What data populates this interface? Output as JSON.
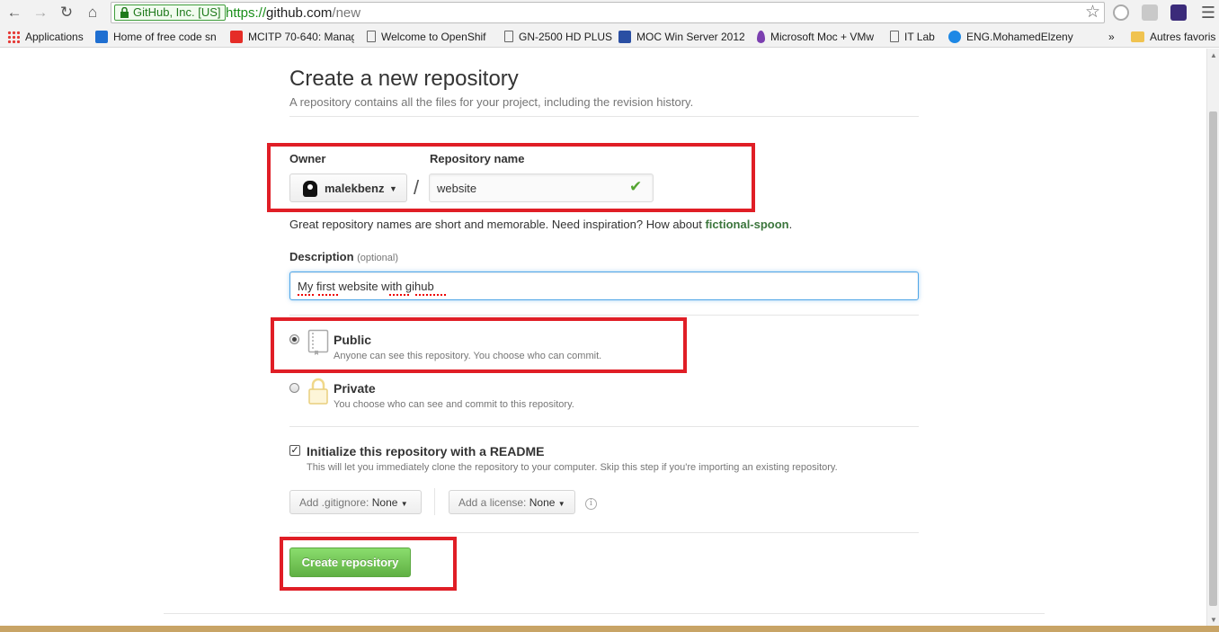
{
  "browser": {
    "ev_badge": "GitHub, Inc. [US]",
    "url_scheme": "https://",
    "url_host": "github.com",
    "url_path": "/new",
    "bookmarks": [
      {
        "label": "Applications"
      },
      {
        "label": "Home of free code sn"
      },
      {
        "label": "MCITP 70-640: Manag"
      },
      {
        "label": "Welcome to OpenShif"
      },
      {
        "label": "GN-2500 HD PLUS"
      },
      {
        "label": "MOC Win Server 2012"
      },
      {
        "label": "Microsoft Moc + VMw"
      },
      {
        "label": "IT Lab"
      },
      {
        "label": "ENG.MohamedElzeny"
      }
    ],
    "more_bookmarks": "»",
    "other_bookmarks": "Autres favoris"
  },
  "page": {
    "title": "Create a new repository",
    "subtitle": "A repository contains all the files for your project, including the revision history.",
    "owner_label": "Owner",
    "owner_value": "malekbenz",
    "slash": "/",
    "repo_label": "Repository name",
    "repo_value": "website",
    "hint_text": "Great repository names are short and memorable. Need inspiration? How about ",
    "hint_suggestion": "fictional-spoon",
    "hint_end": ".",
    "description_label": "Description",
    "description_optional": "(optional)",
    "description_value": "My first website with gihub",
    "visibility": {
      "public_label": "Public",
      "public_note": "Anyone can see this repository. You choose who can commit.",
      "private_label": "Private",
      "private_note": "You choose who can see and commit to this repository.",
      "selected": "public"
    },
    "readme_label": "Initialize this repository with a README",
    "readme_note": "This will let you immediately clone the repository to your computer. Skip this step if you're importing an existing repository.",
    "readme_checked": true,
    "gitignore_label": "Add .gitignore:",
    "gitignore_value": "None",
    "license_label": "Add a license:",
    "license_value": "None",
    "create_button": "Create repository"
  },
  "colors": {
    "highlight": "#e01e26",
    "create_button": "#60b044",
    "suggestion": "#3c763d"
  }
}
